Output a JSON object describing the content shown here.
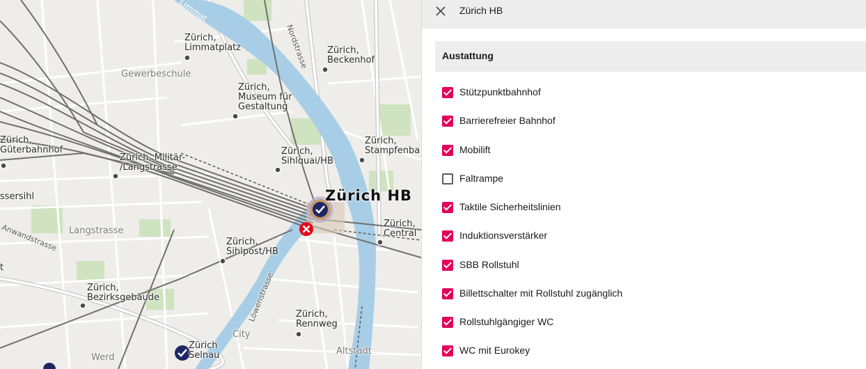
{
  "map": {
    "labels": {
      "limmat_river": "Limmat",
      "nordstrasse": "Nordstrasse",
      "limmatplatz": "Zürich,\nLimmatplatz",
      "beckenhof": "Zürich,\nBeckenhof",
      "gewerbeschule": "Gewerbeschule",
      "museum": "Zürich,\nMuseum für\nGestaltung",
      "gueterbahnhof": "Zürich,\nGüterbahnhof",
      "stampfenbach": "Zürich,\nStampfenba",
      "militaer": "Zürich, Militär-\n/Langstrasse",
      "sihlquai": "Zürich,\nSihlquai/HB",
      "aussersihl": "ssersihl",
      "hb": "Zürich HB",
      "central": "Zürich,\nCentral",
      "langstrasse": "Langstrasse",
      "anwandstrasse": "Anwandstrasse",
      "sihlpost": "Zürich,\nSihlpost/HB",
      "bezirk": "Zürich,\nBezirksgebäude",
      "loewenstrasse": "Löwenstrasse",
      "rennweg": "Zürich,\nRennweg",
      "city": "City",
      "selnau": "Zürich\nSelnau",
      "werd": "Werd",
      "altstadt": "Altstadt",
      "t": "t"
    }
  },
  "panel": {
    "title": "Zürich HB",
    "close_icon": "close-icon",
    "section_title": "Austattung",
    "accent_color": "#e2005a",
    "items": [
      {
        "label": "Stützpunktbahnhof",
        "checked": true
      },
      {
        "label": "Barrierefreier Bahnhof",
        "checked": true
      },
      {
        "label": "Mobilift",
        "checked": true
      },
      {
        "label": "Faltrampe",
        "checked": false
      },
      {
        "label": "Taktile Sicherheitslinien",
        "checked": true
      },
      {
        "label": "Induktionsverstärker",
        "checked": true
      },
      {
        "label": "SBB Rollstuhl",
        "checked": true
      },
      {
        "label": "Billettschalter mit Rollstuhl zugänglich",
        "checked": true
      },
      {
        "label": "Rollstuhlgängiger WC",
        "checked": true
      },
      {
        "label": "WC mit Eurokey",
        "checked": true
      }
    ]
  }
}
